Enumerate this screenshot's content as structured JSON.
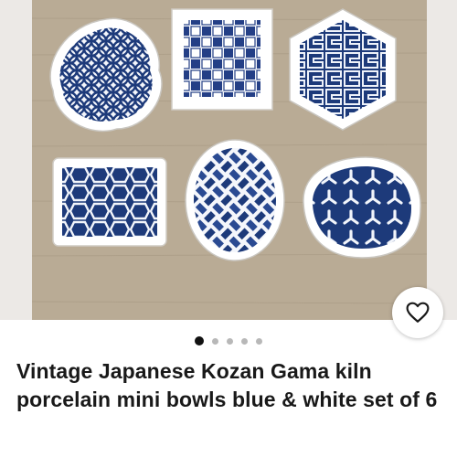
{
  "listing": {
    "title": "Vintage Japanese Kozan Gama kiln porcelain mini bowls blue & white set of 6",
    "image_alt": "Six blue and white porcelain mini bowls"
  },
  "gallery": {
    "total_images": 5,
    "active_index": 0
  },
  "actions": {
    "watch_icon": "heart-outline-icon"
  },
  "colors": {
    "cobalt": "#1d3a7a",
    "background": "#b9ab95",
    "text": "#191919"
  }
}
